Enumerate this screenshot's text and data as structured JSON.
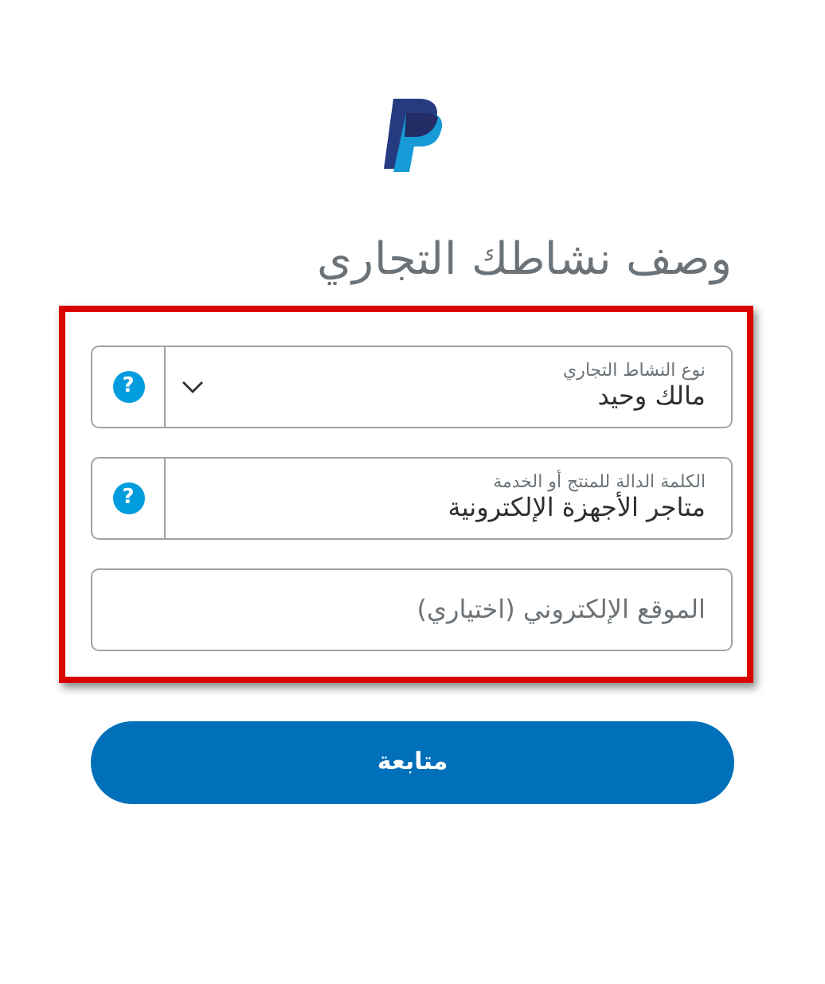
{
  "title": "وصف نشاطك التجاري",
  "fields": [
    {
      "kind": "select",
      "label": "نوع النشاط التجاري",
      "value": "مالك وحيد",
      "help": "?"
    },
    {
      "kind": "text",
      "label": "الكلمة الدالة للمنتج أو الخدمة",
      "value": "متاجر الأجهزة الإلكترونية",
      "help": "?"
    },
    {
      "kind": "text",
      "placeholder": "الموقع الإلكتروني (اختياري)"
    }
  ],
  "button": "متابعة"
}
